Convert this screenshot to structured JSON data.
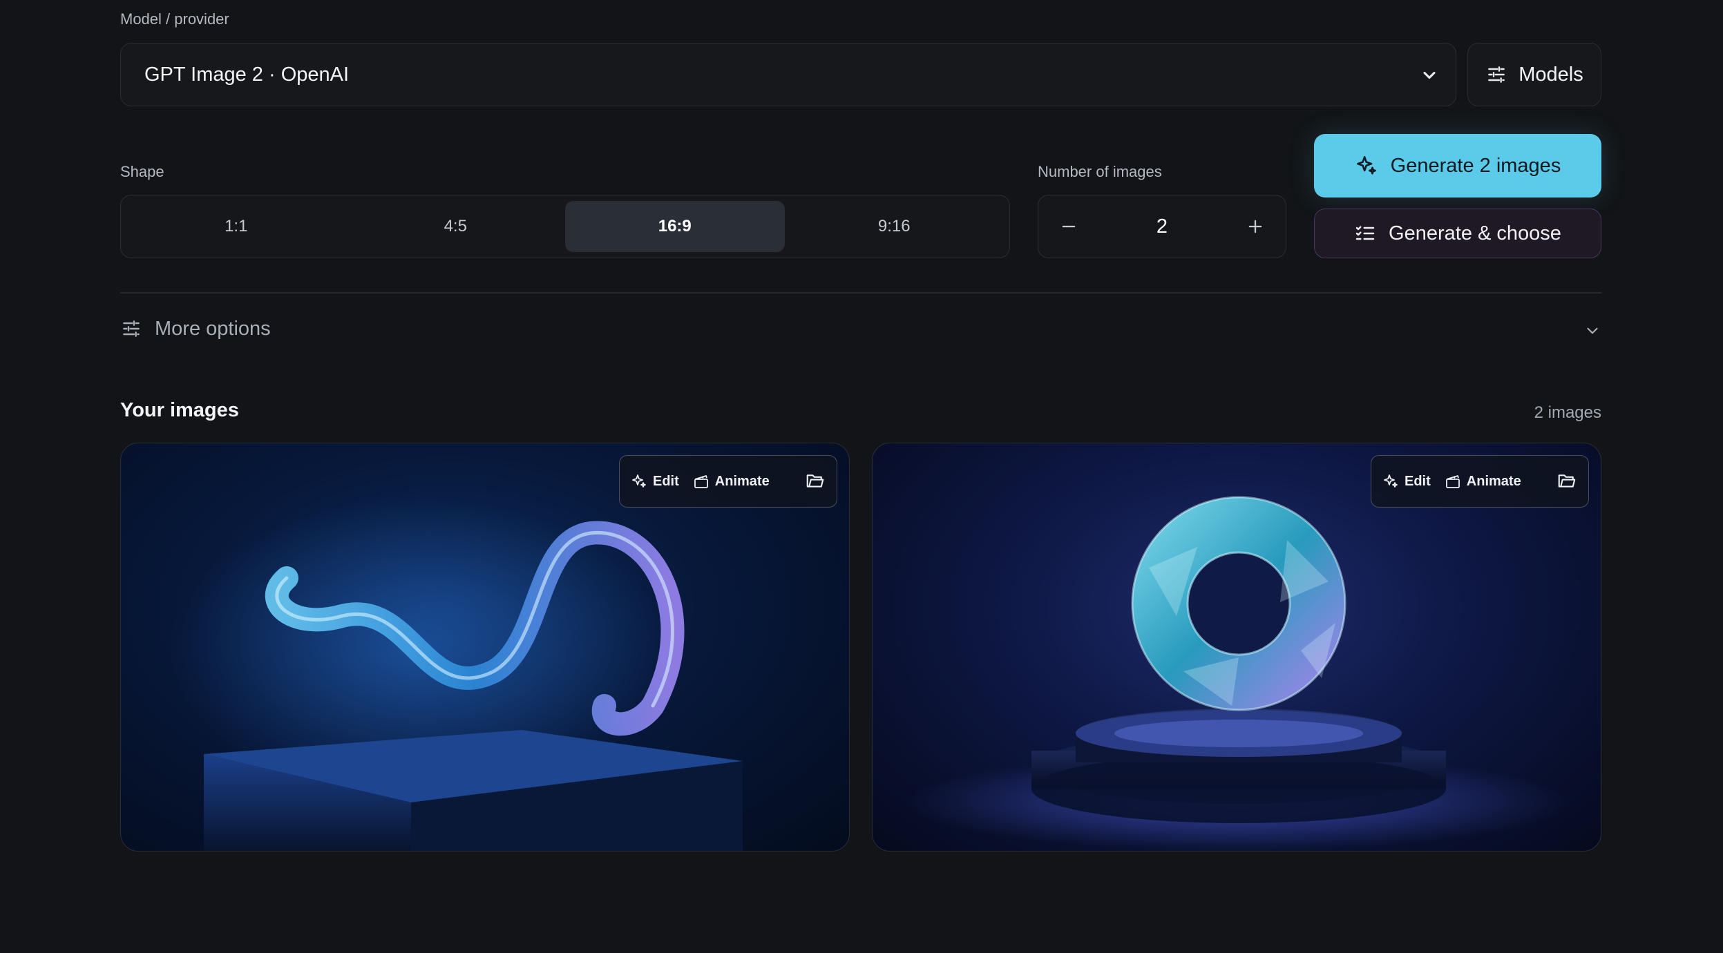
{
  "model": {
    "label": "Model / provider",
    "selected": "GPT Image 2 · OpenAI",
    "models_button": "Models"
  },
  "shape": {
    "label": "Shape",
    "options": [
      "1:1",
      "4:5",
      "16:9",
      "9:16"
    ],
    "selected": "16:9"
  },
  "count": {
    "label": "Number of images",
    "value": "2"
  },
  "actions": {
    "generate": "Generate 2 images",
    "generate_choose": "Generate & choose"
  },
  "more_options": "More options",
  "gallery": {
    "title": "Your images",
    "count": "2 images",
    "toolbar": {
      "edit": "Edit",
      "animate": "Animate"
    }
  },
  "colors": {
    "background": "#121417",
    "accent": "#5ccbe9",
    "secondary_border": "#4b3660"
  }
}
